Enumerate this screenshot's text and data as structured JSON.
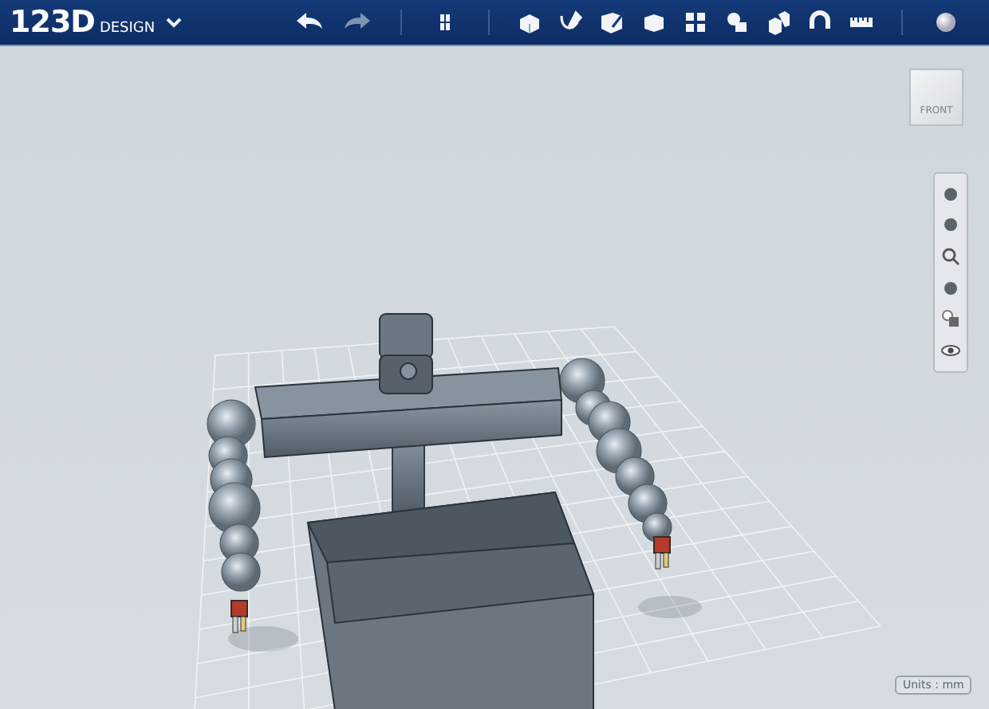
{
  "app": {
    "logo": "123D",
    "logo_sub": "DESIGN"
  },
  "view_cube": {
    "face_label": "FRONT"
  },
  "status": {
    "units": "Units : mm"
  }
}
